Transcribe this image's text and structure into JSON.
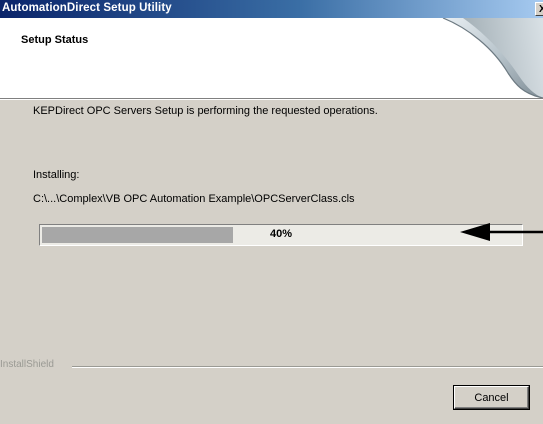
{
  "window": {
    "title": "AutomationDirect Setup Utility",
    "close_label": "X"
  },
  "header": {
    "title": "Setup Status"
  },
  "body": {
    "status_text": "KEPDirect OPC Servers Setup is performing the requested operations.",
    "installing_label": "Installing:",
    "file_path": "C:\\...\\Complex\\VB OPC Automation Example\\OPCServerClass.cls"
  },
  "progress": {
    "label": "40%",
    "fraction": 0.4
  },
  "footer": {
    "brand": "InstallShield",
    "cancel_label": "Cancel"
  },
  "colors": {
    "titlebar_start": "#0a246a",
    "titlebar_end": "#a6caf0",
    "dialog_bg": "#d4d0c8",
    "progress_fill": "#a7a7a7"
  },
  "icons": {
    "header_graphic": "page-curl-icon",
    "callout": "left-arrow-icon"
  }
}
